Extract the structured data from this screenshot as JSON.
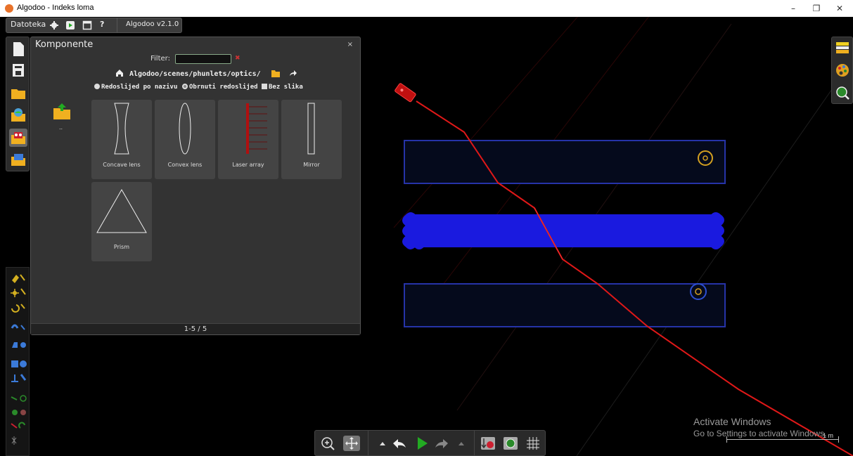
{
  "window": {
    "title": "Algodoo - Indeks loma",
    "min_label": "–",
    "restore_label": "❐",
    "close_label": "✕"
  },
  "menubar": {
    "file_label": "Datoteka",
    "help_label": "?",
    "version_label": "Algodoo v2.1.0"
  },
  "panel": {
    "title": "Komponente",
    "close_label": "×",
    "filter_label": "Filter:",
    "filter_value": "",
    "path": "Algodoo/scenes/phunlets/optics/",
    "up_label": "..",
    "sort_by_name": "Redoslijed po nazivu",
    "reverse_order": "Obrnuti redoslijed",
    "no_images": "Bez slika",
    "pager": "1-5 / 5",
    "items": [
      {
        "label": "Concave lens"
      },
      {
        "label": "Convex lens"
      },
      {
        "label": "Laser array"
      },
      {
        "label": "Mirror"
      },
      {
        "label": "Prism"
      }
    ]
  },
  "overlay": {
    "activate_title": "Activate Windows",
    "activate_sub": "Go to Settings to activate Windows.",
    "scale_label": "1 m"
  },
  "colors": {
    "laser": "#e01818",
    "water": "#1a1adf",
    "box_border": "#2633a8",
    "accent_green": "#22aa22"
  }
}
